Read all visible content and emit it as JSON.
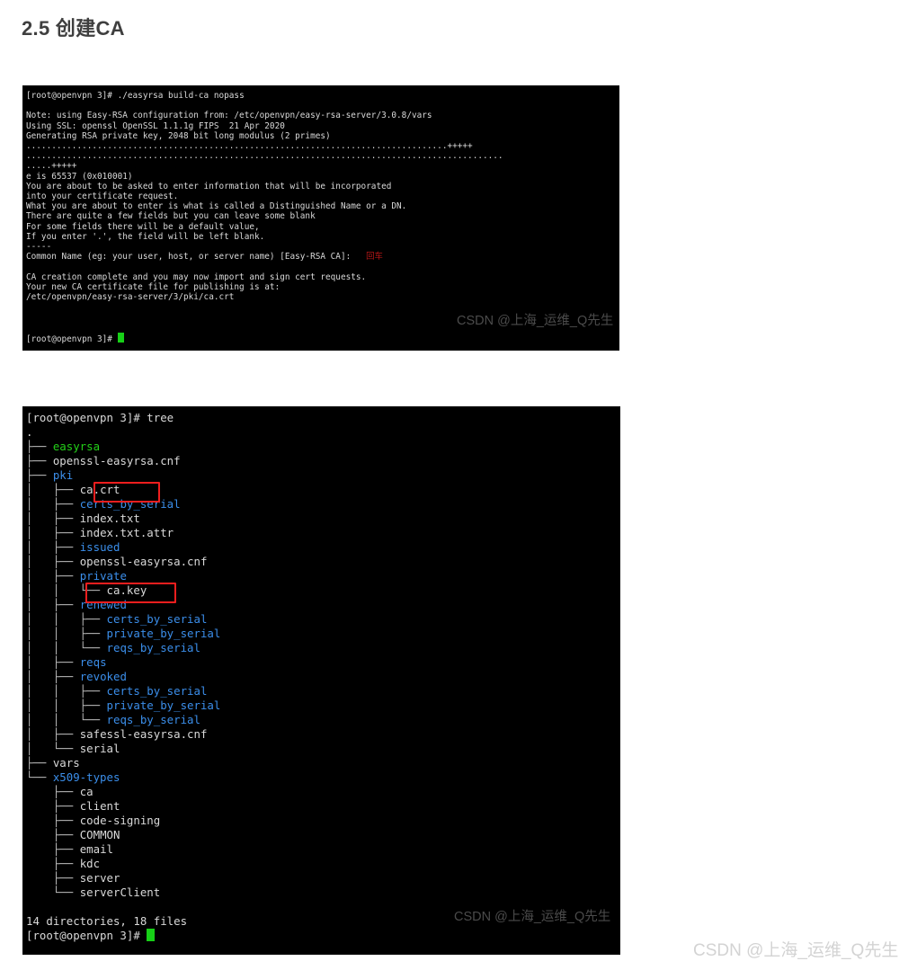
{
  "page": {
    "heading": "2.5 创建CA",
    "watermark": "CSDN @上海_运维_Q先生"
  },
  "terminal_build_ca": {
    "name": "build-ca-terminal",
    "watermark": "CSDN @上海_运维_Q先生",
    "prompt": "[root@openvpn 3]#",
    "command": "./easyrsa build-ca nopass",
    "annotation_red": "回车",
    "lines": [
      "[root@openvpn 3]# ./easyrsa build-ca nopass",
      "",
      "Note: using Easy-RSA configuration from: /etc/openvpn/easy-rsa-server/3.0.8/vars",
      "Using SSL: openssl OpenSSL 1.1.1g FIPS  21 Apr 2020",
      "Generating RSA private key, 2048 bit long modulus (2 primes)",
      "...................................................................................+++++",
      "..............................................................................................",
      ".....+++++",
      "e is 65537 (0x010001)",
      "You are about to be asked to enter information that will be incorporated",
      "into your certificate request.",
      "What you are about to enter is what is called a Distinguished Name or a DN.",
      "There are quite a few fields but you can leave some blank",
      "For some fields there will be a default value,",
      "If you enter '.', the field will be left blank.",
      "-----",
      "Common Name (eg: your user, host, or server name) [Easy-RSA CA]:",
      "",
      "CA creation complete and you may now import and sign cert requests.",
      "Your new CA certificate file for publishing is at:",
      "/etc/openvpn/easy-rsa-server/3/pki/ca.crt",
      "",
      "",
      "[root@openvpn 3]#"
    ],
    "line_0_prompt": "[root@openvpn 3]# ",
    "line_0_cmd": "./easyrsa build-ca nopass",
    "line_note": "Note: using Easy-RSA configuration from: /etc/openvpn/easy-rsa-server/3.0.8/vars",
    "line_ssl": "Using SSL: openssl OpenSSL 1.1.1g FIPS  21 Apr 2020",
    "line_genkey": "Generating RSA private key, 2048 bit long modulus (2 primes)",
    "line_dots1": "...................................................................................+++++",
    "line_dots2": "..............................................................................................",
    "line_dots3": ".....+++++",
    "line_e": "e is 65537 (0x010001)",
    "line_about1": "You are about to be asked to enter information that will be incorporated",
    "line_about2": "into your certificate request.",
    "line_about3": "What you are about to enter is what is called a Distinguished Name or a DN.",
    "line_about4": "There are quite a few fields but you can leave some blank",
    "line_about5": "For some fields there will be a default value,",
    "line_about6": "If you enter '.', the field will be left blank.",
    "line_dashes": "-----",
    "line_common_name": "Common Name (eg: your user, host, or server name) [Easy-RSA CA]:   ",
    "line_complete": "CA creation complete and you may now import and sign cert requests.",
    "line_publish": "Your new CA certificate file for publishing is at:",
    "line_path": "/etc/openvpn/easy-rsa-server/3/pki/ca.crt",
    "line_last_prompt": "[root@openvpn 3]# "
  },
  "terminal_tree": {
    "name": "tree-output-terminal",
    "watermark": "CSDN @上海_运维_Q先生",
    "prompt": "[root@openvpn 3]#",
    "command": "tree",
    "line_cmd_prompt": "[root@openvpn 3]# ",
    "line_cmd": "tree",
    "root": ".",
    "summary": "14 directories, 18 files",
    "line_last_prompt": "[root@openvpn 3]# ",
    "entries": [
      {
        "branch": "├── ",
        "name": "easyrsa",
        "type": "exec"
      },
      {
        "branch": "├── ",
        "name": "openssl-easyrsa.cnf",
        "type": "file"
      },
      {
        "branch": "├── ",
        "name": "pki",
        "type": "dir"
      },
      {
        "branch": "│   ├── ",
        "name": "ca.crt",
        "type": "file",
        "highlight": true
      },
      {
        "branch": "│   ├── ",
        "name": "certs_by_serial",
        "type": "dir"
      },
      {
        "branch": "│   ├── ",
        "name": "index.txt",
        "type": "file"
      },
      {
        "branch": "│   ├── ",
        "name": "index.txt.attr",
        "type": "file"
      },
      {
        "branch": "│   ├── ",
        "name": "issued",
        "type": "dir"
      },
      {
        "branch": "│   ├── ",
        "name": "openssl-easyrsa.cnf",
        "type": "file"
      },
      {
        "branch": "│   ├── ",
        "name": "private",
        "type": "dir"
      },
      {
        "branch": "│   │   └── ",
        "name": "ca.key",
        "type": "file",
        "highlight": true
      },
      {
        "branch": "│   ├── ",
        "name": "renewed",
        "type": "dir"
      },
      {
        "branch": "│   │   ├── ",
        "name": "certs_by_serial",
        "type": "dir"
      },
      {
        "branch": "│   │   ├── ",
        "name": "private_by_serial",
        "type": "dir"
      },
      {
        "branch": "│   │   └── ",
        "name": "reqs_by_serial",
        "type": "dir"
      },
      {
        "branch": "│   ├── ",
        "name": "reqs",
        "type": "dir"
      },
      {
        "branch": "│   ├── ",
        "name": "revoked",
        "type": "dir"
      },
      {
        "branch": "│   │   ├── ",
        "name": "certs_by_serial",
        "type": "dir"
      },
      {
        "branch": "│   │   ├── ",
        "name": "private_by_serial",
        "type": "dir"
      },
      {
        "branch": "│   │   └── ",
        "name": "reqs_by_serial",
        "type": "dir"
      },
      {
        "branch": "│   ├── ",
        "name": "safessl-easyrsa.cnf",
        "type": "file"
      },
      {
        "branch": "│   └── ",
        "name": "serial",
        "type": "file"
      },
      {
        "branch": "├── ",
        "name": "vars",
        "type": "file"
      },
      {
        "branch": "└── ",
        "name": "x509-types",
        "type": "dir"
      },
      {
        "branch": "    ├── ",
        "name": "ca",
        "type": "file"
      },
      {
        "branch": "    ├── ",
        "name": "client",
        "type": "file"
      },
      {
        "branch": "    ├── ",
        "name": "code-signing",
        "type": "file"
      },
      {
        "branch": "    ├── ",
        "name": "COMMON",
        "type": "file"
      },
      {
        "branch": "    ├── ",
        "name": "email",
        "type": "file"
      },
      {
        "branch": "    ├── ",
        "name": "kdc",
        "type": "file"
      },
      {
        "branch": "    ├── ",
        "name": "server",
        "type": "file"
      },
      {
        "branch": "    └── ",
        "name": "serverClient",
        "type": "file"
      }
    ]
  },
  "colors": {
    "terminal_bg": "#000000",
    "terminal_fg": "#d9d9d9",
    "directory": "#3b8eea",
    "executable": "#23d018",
    "cursor": "#17d017",
    "annotation_red": "#f01e1e",
    "heading": "#3f3f3f",
    "watermark": "#d3d3d3"
  }
}
